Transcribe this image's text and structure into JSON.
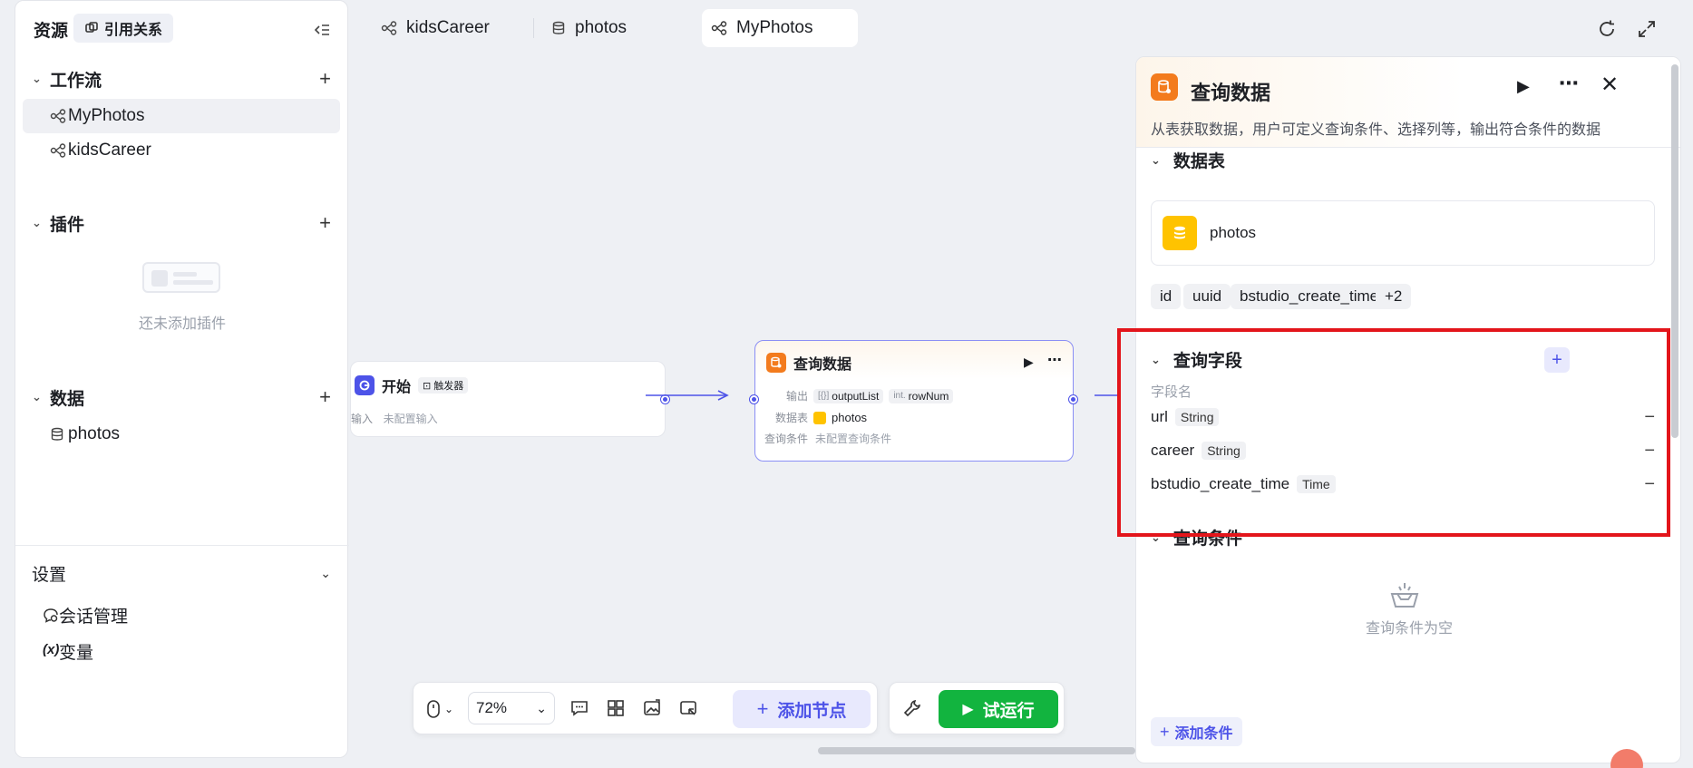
{
  "sidebar": {
    "title": "资源",
    "ref_button": "引用关系",
    "sections": {
      "workflow": {
        "label": "工作流",
        "items": [
          "MyPhotos",
          "kidsCareer"
        ]
      },
      "plugins": {
        "label": "插件",
        "empty_text": "还未添加插件"
      },
      "data": {
        "label": "数据",
        "items": [
          "photos"
        ]
      }
    },
    "settings": {
      "label": "设置",
      "items": [
        {
          "label": "会话管理",
          "icon": "chat-settings-icon"
        },
        {
          "label": "变量",
          "icon": "variable-icon"
        }
      ]
    }
  },
  "tabs": [
    {
      "label": "kidsCareer",
      "icon": "workflow-icon"
    },
    {
      "label": "photos",
      "icon": "database-icon"
    },
    {
      "label": "MyPhotos",
      "icon": "workflow-icon",
      "active": true
    }
  ],
  "canvas": {
    "start_node": {
      "title": "开始",
      "badge": "触发器",
      "input_label": "输入",
      "input_value": "未配置输入"
    },
    "query_node": {
      "title": "查询数据",
      "output_label": "输出",
      "output_items": [
        {
          "type": "[{}]",
          "name": "outputList"
        },
        {
          "type": "int.",
          "name": "rowNum"
        }
      ],
      "table_label": "数据表",
      "table_value": "photos",
      "cond_label": "查询条件",
      "cond_value": "未配置查询条件"
    }
  },
  "toolbar": {
    "zoom": "72%",
    "add_node": "添加节点",
    "run": "试运行"
  },
  "panel": {
    "title": "查询数据",
    "description": "从表获取数据，用户可定义查询条件、选择列等，输出符合条件的数据",
    "table_section": "数据表",
    "table_name": "photos",
    "columns": [
      "id",
      "uuid",
      "bstudio_create_time",
      "+2"
    ],
    "fields_section": "查询字段",
    "field_header": "字段名",
    "fields": [
      {
        "name": "url",
        "type": "String"
      },
      {
        "name": "career",
        "type": "String"
      },
      {
        "name": "bstudio_create_time",
        "type": "Time"
      }
    ],
    "conditions_section": "查询条件",
    "conditions_empty": "查询条件为空",
    "add_condition": "添加条件"
  },
  "colors": {
    "accent": "#4d53e8",
    "run": "#12b43f",
    "highlight": "#e3151b",
    "db_orange": "#f37b1d",
    "db_yellow": "#ffc300"
  }
}
